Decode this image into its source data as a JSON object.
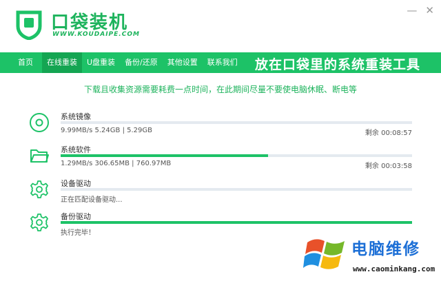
{
  "app": {
    "title": "口袋装机",
    "url": "WWW.KOUDAIPE.COM"
  },
  "window_controls": {
    "minimize": "—",
    "close": "✕"
  },
  "nav": {
    "items": [
      {
        "label": "首页",
        "active": false
      },
      {
        "label": "在线重装",
        "active": true
      },
      {
        "label": "U盘重装",
        "active": false
      },
      {
        "label": "备份/还原",
        "active": false
      },
      {
        "label": "其他设置",
        "active": false
      },
      {
        "label": "联系我们",
        "active": false
      }
    ],
    "slogan": "放在口袋里的系统重装工具"
  },
  "notice": "下载且收集资源需要耗费一点时间，在此期间尽量不要使电脑休眠、断电等",
  "tasks": [
    {
      "icon": "disc-icon",
      "title": "系统镜像",
      "detail": "9.99MB/s 5.24GB | 5.29GB",
      "remaining": "剩余 00:08:57",
      "progress": 0.0
    },
    {
      "icon": "folder-icon",
      "title": "系统软件",
      "detail": "1.29MB/s 306.65MB | 760.97MB",
      "remaining": "剩余 00:03:58",
      "progress": 0.59
    },
    {
      "icon": "gear-icon",
      "title": "设备驱动",
      "detail": "正在匹配设备驱动...",
      "remaining": "",
      "progress": 0.0
    },
    {
      "icon": "gear-icon",
      "title": "备份驱动",
      "detail": "执行完毕！",
      "remaining": "",
      "progress": 1.0
    }
  ],
  "colors": {
    "accent": "#1dc267",
    "accent_dark": "#14a552",
    "track": "#e4eaf0"
  },
  "watermark": {
    "title": "电脑维修",
    "url": "www.caominkang.com"
  }
}
